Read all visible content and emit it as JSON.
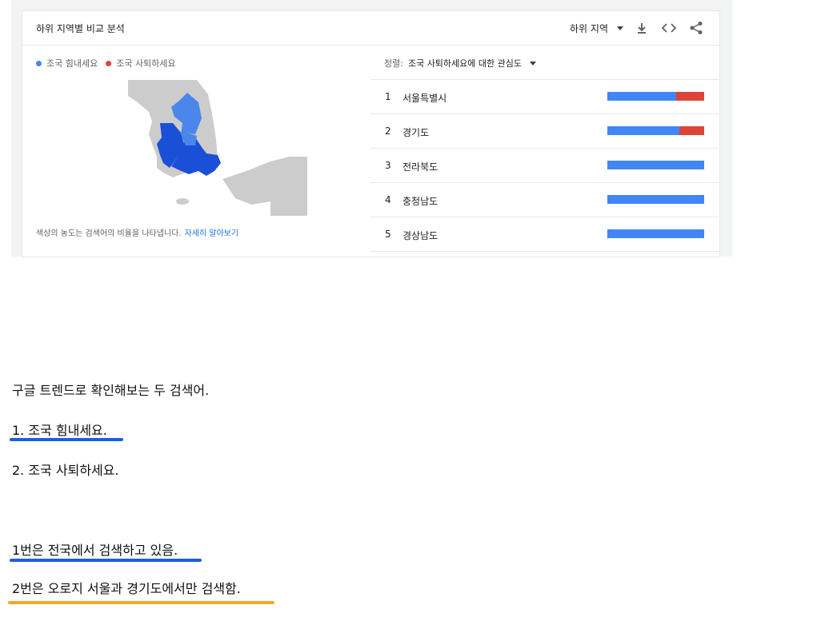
{
  "card": {
    "title": "하위 지역별 비교 분석",
    "region_select": "하위 지역",
    "icons": [
      "download-icon",
      "embed-code-icon",
      "share-icon"
    ]
  },
  "legend": [
    {
      "label": "조국 힘내세요",
      "color": "#4285f4"
    },
    {
      "label": "조국 사퇴하세요",
      "color": "#db4437"
    }
  ],
  "map": {
    "region_color_a": "#1a4fd8",
    "region_color_b": "#4a86ec",
    "land_color": "#cccccc"
  },
  "footnote": {
    "text": "색상의 농도는 검색어의 비율을 나타냅니다.",
    "link": "자세히 알아보기"
  },
  "sort": {
    "label": "정렬:",
    "value": "조국 사퇴하세요에 대한 관심도"
  },
  "rows": [
    {
      "rank": "1",
      "name": "서울특별시",
      "share_a": 0.71
    },
    {
      "rank": "2",
      "name": "경기도",
      "share_a": 0.74
    },
    {
      "rank": "3",
      "name": "전라북도",
      "share_a": 1.0
    },
    {
      "rank": "4",
      "name": "충청남도",
      "share_a": 1.0
    },
    {
      "rank": "5",
      "name": "경상남도",
      "share_a": 1.0
    }
  ],
  "body": {
    "line1": "구글 트렌드로 확인해보는 두 검색어.",
    "line2": "1. 조국 힘내세요.",
    "line3": "2. 조국 사퇴하세요.",
    "line4": "1번은 전국에서 검색하고 있음.",
    "line5": "2번은 오로지 서울과 경기도에서만 검색함."
  },
  "underline_colors": {
    "blue": "#1a5fe0",
    "orange": "#f5a623"
  }
}
